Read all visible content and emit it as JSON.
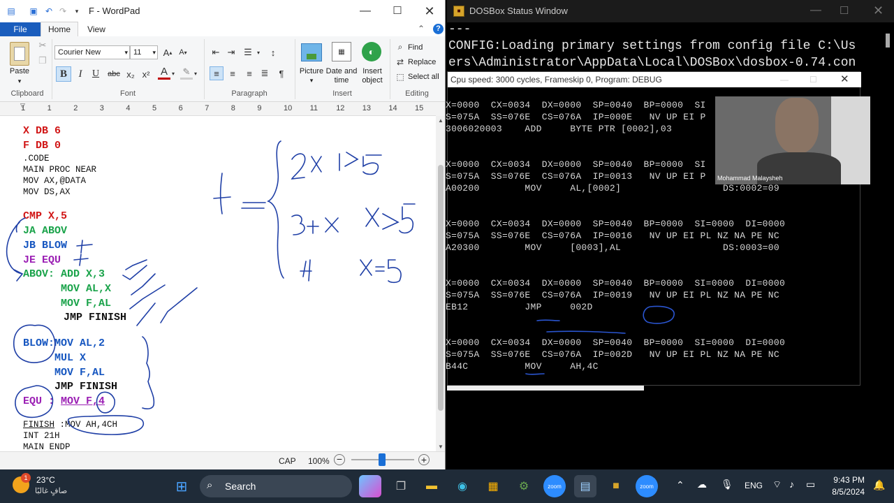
{
  "wordpad": {
    "title": "F - WordPad",
    "tabs": {
      "file": "File",
      "home": "Home",
      "view": "View"
    },
    "clipboard": {
      "paste": "Paste",
      "group": "Clipboard"
    },
    "font": {
      "family": "Courier New",
      "size": "11",
      "group": "Font",
      "bold": "B",
      "italic": "I",
      "underline": "U",
      "strike": "abc",
      "sub": "x₂",
      "sup": "x²",
      "color_letter": "A"
    },
    "paragraph": {
      "group": "Paragraph"
    },
    "insert": {
      "picture": "Picture",
      "datetime_1": "Date and",
      "datetime_2": "time",
      "object_1": "Insert",
      "object_2": "object",
      "group": "Insert"
    },
    "editing": {
      "find": "Find",
      "replace": "Replace",
      "select_all": "Select all",
      "group": "Editing"
    },
    "ruler_numbers": [
      "1",
      "1",
      "2",
      "3",
      "4",
      "5",
      "6",
      "7",
      "8",
      "9",
      "10",
      "11",
      "12",
      "13",
      "14",
      "15"
    ],
    "code": {
      "l1": "X DB 6",
      "l2": "F DB 0",
      "l3": ".CODE",
      "l4": "MAIN PROC NEAR",
      "l5": "MOV AX,@DATA",
      "l6": "MOV DS,AX",
      "l7": "CMP X,5",
      "l8": "JA ABOV",
      "l9": "JB BLOW",
      "l10": "JE EQU",
      "l11": "ABOV: ADD X,3",
      "l12": "      MOV AL,X",
      "l13": "      MOV F,AL",
      "l14": "      JMP FINISH",
      "l15a": "BLOW",
      "l15b": ":MOV AL,2",
      "l16": "     MUL X",
      "l17": "     MOV F,AL",
      "l18": "     JMP FINISH",
      "l19a": "EQU",
      "l19b": " : ",
      "l19c": "MOV F,4",
      "l20a": "FINISH",
      "l20b": " :MOV AH,4CH",
      "l21": "INT 21H",
      "l22": "MAIN ENDP"
    },
    "status": {
      "caps": "CAP",
      "zoom": "100%"
    }
  },
  "dosbox": {
    "title": "DOSBox Status Window",
    "line0": "---",
    "line1": "CONFIG:Loading primary settings from config file C:\\Us",
    "line2": "ers\\Administrator\\AppData\\Local\\DOSBox\\dosbox-0.74.con"
  },
  "debug": {
    "title": "Cpu speed:    3000 cycles, Frameskip  0, Program:    DEBUG",
    "lines": [
      "X=0000  CX=0034  DX=0000  SP=0040  BP=0000  SI",
      "S=075A  SS=076E  CS=076A  IP=000E   NV UP EI P",
      "3006020003    ADD     BYTE PTR [0002],03",
      "X=0000  CX=0034  DX=0000  SP=0040  BP=0000  SI",
      "S=075A  SS=076E  CS=076A  IP=0013   NV UP EI P",
      "A00200        MOV     AL,[0002]                  DS:0002=09",
      "X=0000  CX=0034  DX=0000  SP=0040  BP=0000  SI=0000  DI=0000",
      "S=075A  SS=076E  CS=076A  IP=0016   NV UP EI PL NZ NA PE NC",
      "A20300        MOV     [0003],AL                  DS:0003=00",
      "X=0000  CX=0034  DX=0000  SP=0040  BP=0000  SI=0000  DI=0000",
      "S=075A  SS=076E  CS=076A  IP=0019   NV UP EI PL NZ NA PE NC",
      "EB12          JMP     002D",
      "X=0000  CX=0034  DX=0000  SP=0040  BP=0000  SI=0000  DI=0000",
      "S=075A  SS=076E  CS=076A  IP=002D   NV UP EI PL NZ NA PE NC",
      "B44C          MOV     AH,4C"
    ],
    "camera_name": "Mohammad Malaysheh"
  },
  "taskbar": {
    "weather_temp": "23°C",
    "weather_desc": "صافٍ غالبًا",
    "weather_badge": "1",
    "search": "Search",
    "lang": "ENG",
    "time": "9:43 PM",
    "date": "8/5/2024"
  }
}
